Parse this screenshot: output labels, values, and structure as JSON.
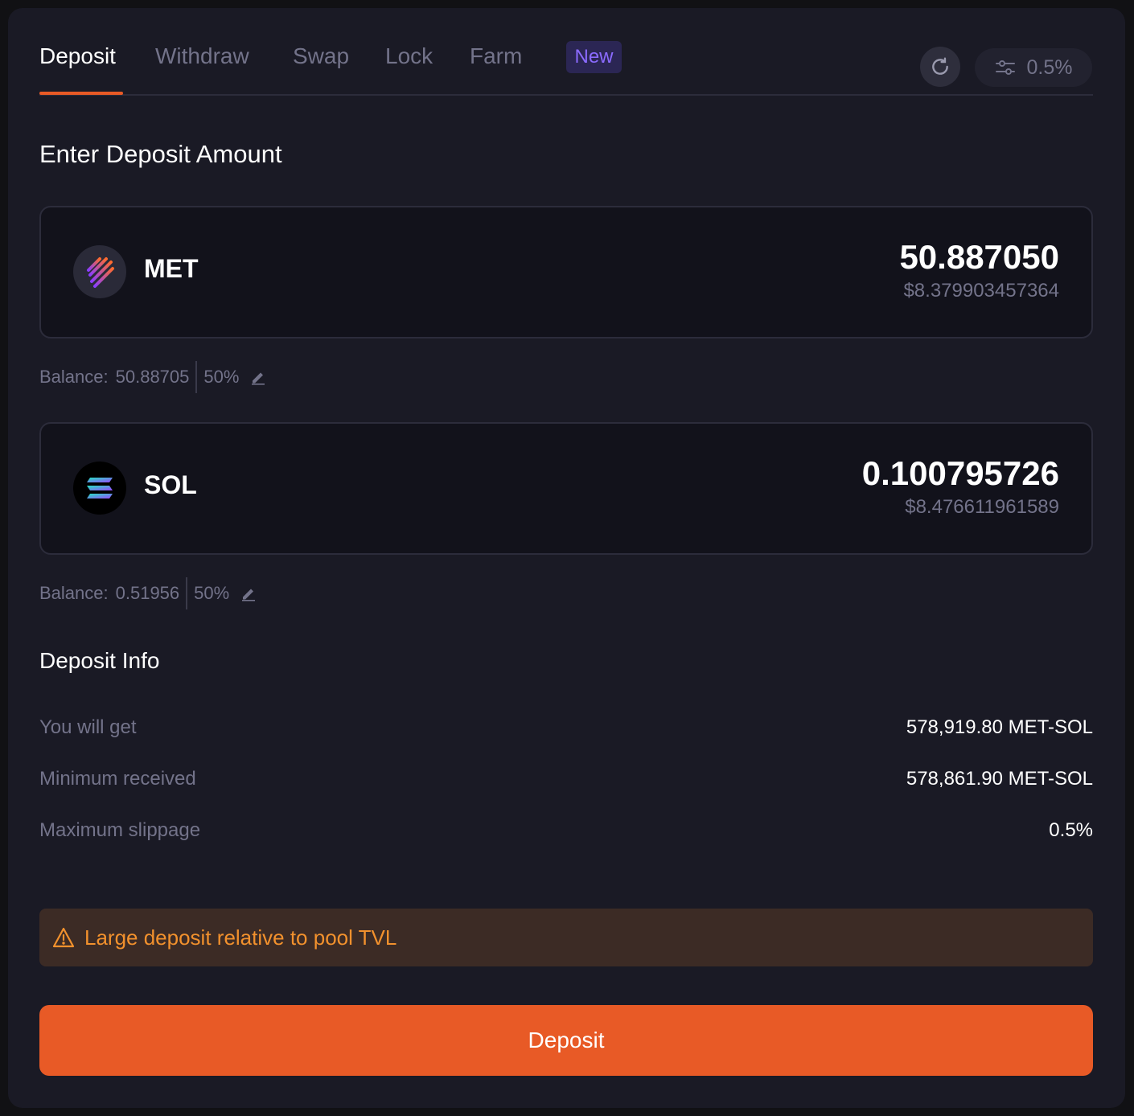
{
  "tabs": [
    {
      "label": "Deposit",
      "active": true
    },
    {
      "label": "Withdraw",
      "active": false
    },
    {
      "label": "Swap",
      "active": false
    },
    {
      "label": "Lock",
      "active": false
    },
    {
      "label": "Farm",
      "active": false
    }
  ],
  "farm_badge": "New",
  "slippage_button": {
    "value": "0.5%",
    "icon": "sliders-icon"
  },
  "refresh_icon": "refresh-icon",
  "section_title": "Enter Deposit Amount",
  "tokens": [
    {
      "symbol": "MET",
      "icon": "met-token-icon",
      "amount": "50.887050",
      "usd": "$8.379903457364",
      "balance_label": "Balance:",
      "balance": "50.88705",
      "percent": "50%"
    },
    {
      "symbol": "SOL",
      "icon": "sol-token-icon",
      "amount": "0.100795726",
      "usd": "$8.476611961589",
      "balance_label": "Balance:",
      "balance": "0.51956",
      "percent": "50%"
    }
  ],
  "info_title": "Deposit Info",
  "info": [
    {
      "label": "You will get",
      "value": "578,919.80 MET-SOL"
    },
    {
      "label": "Minimum received",
      "value": "578,861.90 MET-SOL"
    },
    {
      "label": "Maximum slippage",
      "value": "0.5%"
    }
  ],
  "warning": {
    "icon": "warning-icon",
    "text": "Large deposit relative to pool TVL"
  },
  "deposit_button": "Deposit",
  "colors": {
    "accent": "#e85a26",
    "warning": "#f2912d",
    "badge": "#8b6bff",
    "background": "#1a1a25"
  }
}
